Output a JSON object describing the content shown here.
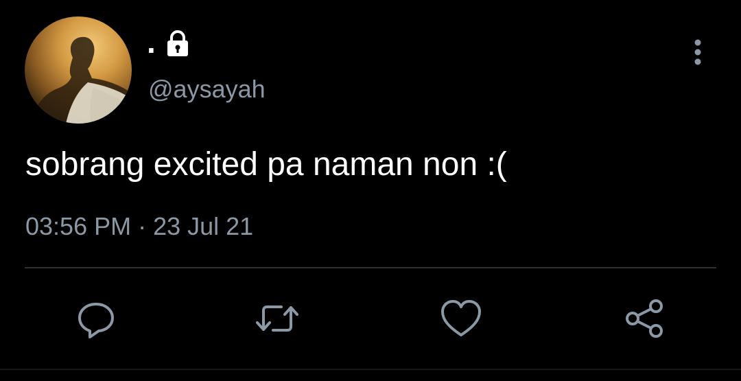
{
  "tweet": {
    "display_name": ".",
    "handle": "@aysayah",
    "text": "sobrang excited pa naman non :(",
    "timestamp": "03:56 PM · 23 Jul 21",
    "account_protected_icon": "lock-icon",
    "more_icon": "more-vertical-icon"
  },
  "actions": [
    {
      "name": "reply",
      "icon": "reply-icon"
    },
    {
      "name": "retweet",
      "icon": "retweet-icon"
    },
    {
      "name": "like",
      "icon": "heart-icon"
    },
    {
      "name": "share",
      "icon": "share-icon"
    }
  ],
  "colors": {
    "background": "#000000",
    "text_primary": "#ffffff",
    "text_secondary": "#8b98a5",
    "divider": "#2f3336"
  }
}
